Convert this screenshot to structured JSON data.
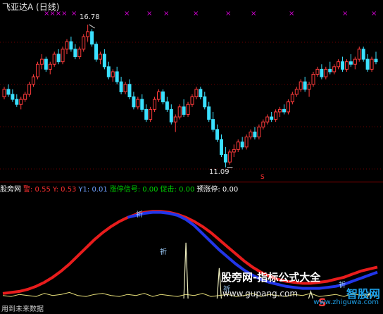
{
  "window": {
    "title": "飞亚达A (日线)"
  },
  "price_chart": {
    "high_label": "16.78",
    "low_label": "11.09",
    "s_marker": "S",
    "top_marks": [
      "××××",
      "×",
      "×",
      "×",
      "×",
      "×",
      "×",
      "×",
      "×",
      "×",
      "×"
    ],
    "colors": {
      "up": "#ff3b3b",
      "down": "#3be0ff",
      "grid": "#6b0000"
    }
  },
  "indicator_header": {
    "name": "股旁网",
    "items": [
      {
        "label": "警: 0.55",
        "color": "#ff3030"
      },
      {
        "label": "Y: 0.53",
        "color": "#ff3030"
      },
      {
        "label": "Y1: 0.01",
        "color": "#6fa0ff"
      },
      {
        "label": "涨停信号: 0.00",
        "color": "#00d000"
      },
      {
        "label": "促击: 0.00",
        "color": "#00d000"
      },
      {
        "label": "预涨停: 0.00",
        "color": "#ffffff"
      }
    ]
  },
  "indicator_labels": [
    "祈",
    "祈",
    "祈",
    "祈"
  ],
  "footer": {
    "text": "用到未来数据"
  },
  "watermark": {
    "line1": "股旁网-指标公式大全",
    "line2": "www.gupang.com"
  },
  "logo": {
    "text": "智股网",
    "sub": "www.zhiguwa.com",
    "mark": "S"
  },
  "chart_data": {
    "type": "candlestick",
    "title": "飞亚达A (日线)",
    "annotations": [
      {
        "text": "16.78",
        "kind": "high"
      },
      {
        "text": "11.09",
        "kind": "low"
      }
    ],
    "candles": [
      [
        13.9,
        14.3,
        13.8,
        14.2
      ],
      [
        14.2,
        14.4,
        13.9,
        14.0
      ],
      [
        14.0,
        14.2,
        13.7,
        13.8
      ],
      [
        13.8,
        14.0,
        13.5,
        13.6
      ],
      [
        13.6,
        13.9,
        13.4,
        13.8
      ],
      [
        13.8,
        14.1,
        13.7,
        14.0
      ],
      [
        14.0,
        14.5,
        13.9,
        14.4
      ],
      [
        14.4,
        14.8,
        14.3,
        14.7
      ],
      [
        14.7,
        15.3,
        14.6,
        15.2
      ],
      [
        15.2,
        15.6,
        15.0,
        15.4
      ],
      [
        15.4,
        15.5,
        14.9,
        15.0
      ],
      [
        15.0,
        15.3,
        14.8,
        15.2
      ],
      [
        15.2,
        15.7,
        15.1,
        15.6
      ],
      [
        15.6,
        15.8,
        15.2,
        15.3
      ],
      [
        15.3,
        15.9,
        15.2,
        15.8
      ],
      [
        15.8,
        16.2,
        15.6,
        16.1
      ],
      [
        16.1,
        16.3,
        15.7,
        15.8
      ],
      [
        15.8,
        16.0,
        15.4,
        15.5
      ],
      [
        15.5,
        15.9,
        15.4,
        15.8
      ],
      [
        15.8,
        16.4,
        15.7,
        16.3
      ],
      [
        16.3,
        16.78,
        16.1,
        16.5
      ],
      [
        16.5,
        16.6,
        15.9,
        16.0
      ],
      [
        16.0,
        16.1,
        15.3,
        15.4
      ],
      [
        15.4,
        15.7,
        15.2,
        15.6
      ],
      [
        15.6,
        15.8,
        15.0,
        15.1
      ],
      [
        15.1,
        15.3,
        14.6,
        14.7
      ],
      [
        14.7,
        15.0,
        14.5,
        14.9
      ],
      [
        14.9,
        15.1,
        14.4,
        14.5
      ],
      [
        14.5,
        14.7,
        14.0,
        14.1
      ],
      [
        14.1,
        14.5,
        14.0,
        14.4
      ],
      [
        14.4,
        14.6,
        13.8,
        13.9
      ],
      [
        13.9,
        14.1,
        13.4,
        13.5
      ],
      [
        13.5,
        13.9,
        13.4,
        13.8
      ],
      [
        13.8,
        14.0,
        13.3,
        13.4
      ],
      [
        13.4,
        13.6,
        12.9,
        13.0
      ],
      [
        13.0,
        13.5,
        12.9,
        13.4
      ],
      [
        13.4,
        13.9,
        13.3,
        13.8
      ],
      [
        13.8,
        14.2,
        13.7,
        14.1
      ],
      [
        14.1,
        14.2,
        13.6,
        13.7
      ],
      [
        13.7,
        13.9,
        13.3,
        13.4
      ],
      [
        13.4,
        13.6,
        12.8,
        12.9
      ],
      [
        12.9,
        13.2,
        12.5,
        13.1
      ],
      [
        13.1,
        13.6,
        13.0,
        13.5
      ],
      [
        13.5,
        13.8,
        13.1,
        13.2
      ],
      [
        13.2,
        13.7,
        13.1,
        13.6
      ],
      [
        13.6,
        14.0,
        13.5,
        13.9
      ],
      [
        13.9,
        14.3,
        13.8,
        14.2
      ],
      [
        14.2,
        14.3,
        13.8,
        13.9
      ],
      [
        13.9,
        14.1,
        13.4,
        13.5
      ],
      [
        13.5,
        13.7,
        12.9,
        13.0
      ],
      [
        13.0,
        13.3,
        12.5,
        12.6
      ],
      [
        12.6,
        12.8,
        12.1,
        12.2
      ],
      [
        12.2,
        12.4,
        11.5,
        11.6
      ],
      [
        11.6,
        11.9,
        11.09,
        11.3
      ],
      [
        11.3,
        11.8,
        11.2,
        11.7
      ],
      [
        11.7,
        12.0,
        11.5,
        11.8
      ],
      [
        11.8,
        12.2,
        11.7,
        12.1
      ],
      [
        12.1,
        12.3,
        11.8,
        11.9
      ],
      [
        11.9,
        12.4,
        11.8,
        12.3
      ],
      [
        12.3,
        12.6,
        12.2,
        12.5
      ],
      [
        12.5,
        12.7,
        12.2,
        12.3
      ],
      [
        12.3,
        12.8,
        12.2,
        12.7
      ],
      [
        12.7,
        13.0,
        12.6,
        12.9
      ],
      [
        12.9,
        13.2,
        12.8,
        13.1
      ],
      [
        13.1,
        13.3,
        12.9,
        13.0
      ],
      [
        13.0,
        13.4,
        12.9,
        13.3
      ],
      [
        13.3,
        13.5,
        13.1,
        13.4
      ],
      [
        13.4,
        13.6,
        13.2,
        13.3
      ],
      [
        13.3,
        13.8,
        13.2,
        13.7
      ],
      [
        13.7,
        14.1,
        13.6,
        14.0
      ],
      [
        14.0,
        14.3,
        13.9,
        14.2
      ],
      [
        14.2,
        14.6,
        14.1,
        14.5
      ],
      [
        14.5,
        14.7,
        14.1,
        14.2
      ],
      [
        14.2,
        14.5,
        13.9,
        14.4
      ],
      [
        14.4,
        14.9,
        14.3,
        14.8
      ],
      [
        14.8,
        15.1,
        14.7,
        15.0
      ],
      [
        15.0,
        15.2,
        14.6,
        14.7
      ],
      [
        14.7,
        15.1,
        14.6,
        15.0
      ],
      [
        15.0,
        15.3,
        14.8,
        14.9
      ],
      [
        14.9,
        15.2,
        14.8,
        15.1
      ],
      [
        15.1,
        15.4,
        15.0,
        15.3
      ],
      [
        15.3,
        15.5,
        14.9,
        15.0
      ],
      [
        15.0,
        15.4,
        14.9,
        15.3
      ],
      [
        15.3,
        15.6,
        15.1,
        15.2
      ],
      [
        15.2,
        15.5,
        15.0,
        15.4
      ],
      [
        15.4,
        15.9,
        15.3,
        15.8
      ],
      [
        15.8,
        15.9,
        15.3,
        15.4
      ],
      [
        15.4,
        15.6,
        14.9,
        15.0
      ],
      [
        15.0,
        15.5,
        14.9,
        15.4
      ],
      [
        15.4,
        15.7,
        15.2,
        15.3
      ]
    ],
    "indicator": {
      "red_line": [
        0.05,
        0.06,
        0.07,
        0.09,
        0.12,
        0.16,
        0.21,
        0.27,
        0.34,
        0.42,
        0.5,
        0.58,
        0.65,
        0.71,
        0.76,
        0.8,
        0.83,
        0.85,
        0.86,
        0.86,
        0.85,
        0.83,
        0.8,
        0.76,
        0.71,
        0.65,
        0.58,
        0.51,
        0.44,
        0.37,
        0.31,
        0.26,
        0.22,
        0.19,
        0.17,
        0.16,
        0.15,
        0.15,
        0.16,
        0.17,
        0.19,
        0.21,
        0.24,
        0.27,
        0.29,
        0.31
      ],
      "blue_line": [
        null,
        null,
        null,
        null,
        null,
        null,
        null,
        null,
        null,
        null,
        null,
        null,
        null,
        null,
        null,
        0.8,
        0.82,
        0.84,
        0.85,
        0.85,
        0.84,
        0.82,
        0.78,
        0.72,
        0.64,
        0.56,
        0.48,
        0.41,
        0.34,
        0.28,
        0.23,
        0.19,
        0.16,
        0.14,
        0.12,
        0.11,
        0.1,
        0.1,
        0.1,
        0.11,
        0.12,
        0.14,
        0.17,
        0.2,
        0.23,
        0.26
      ],
      "yellow_line": [
        0.03,
        0.02,
        0.04,
        0.03,
        0.02,
        0.05,
        0.03,
        0.04,
        0.06,
        0.03,
        0.02,
        0.04,
        0.05,
        0.03,
        0.02,
        0.04,
        0.03,
        0.05,
        0.02,
        0.04,
        0.03,
        0.02,
        0.04,
        0.03,
        0.05,
        0.02,
        0.03,
        0.04,
        0.02,
        0.03,
        0.05,
        0.02,
        0.04,
        0.03,
        0.02,
        0.04,
        0.03,
        0.05,
        0.02,
        0.03,
        0.04,
        0.02,
        0.05,
        0.03,
        0.04,
        0.02
      ],
      "spikes": [
        {
          "index": 22,
          "value": 0.55
        },
        {
          "index": 26,
          "value": 0.3
        },
        {
          "index": 37,
          "value": 0.07
        },
        {
          "index": 44,
          "value": 0.05
        }
      ]
    }
  }
}
